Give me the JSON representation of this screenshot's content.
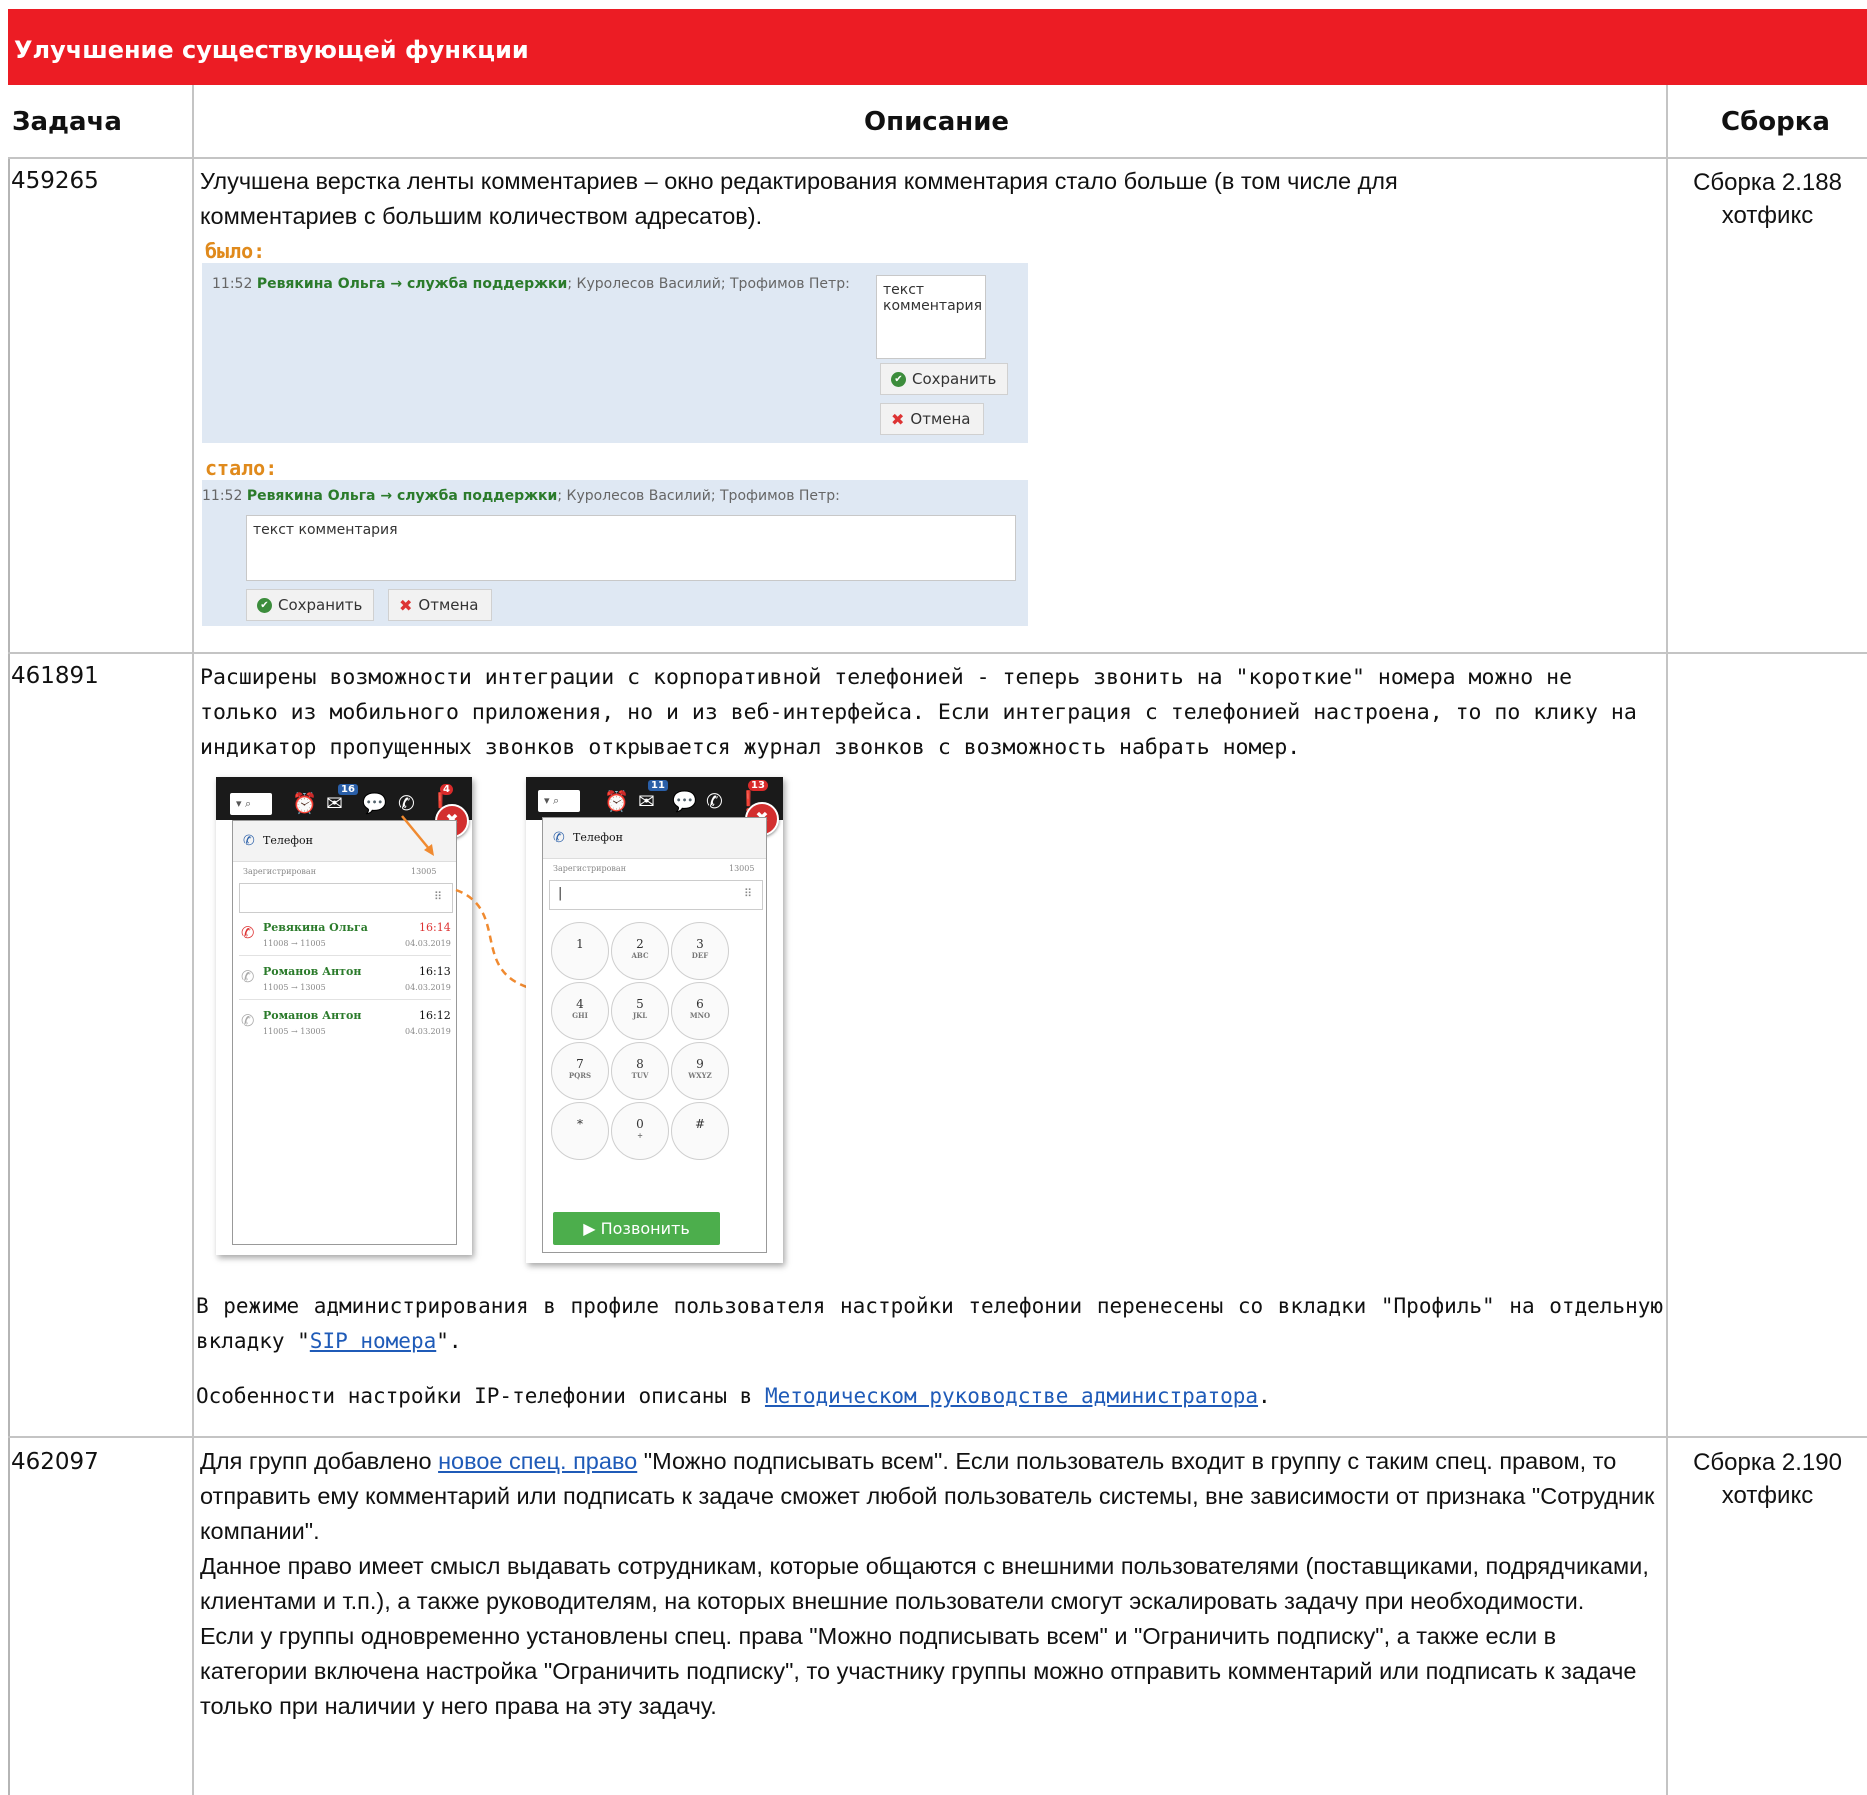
{
  "banner": {
    "title": "Улучшение существующей функции"
  },
  "header": {
    "task": "Задача",
    "description": "Описание",
    "build": "Сборка"
  },
  "rows": [
    {
      "task": "459265",
      "build": "Сборка 2.188 хотфикс",
      "text": "Улучшена верстка ленты комментариев – окно редактирования комментария стало больше (в том числе для комментариев с большим количеством адресатов).",
      "before_label": "было:",
      "after_label": "стало:",
      "comment_time": "11:52",
      "comment_author": "Ревякина Ольга → служба поддержки",
      "comment_recipients": "; Куролесов Василий; Трофимов Петр:",
      "comment_text_old": "текст комментария",
      "comment_text_new": "текст комментария",
      "save": "Сохранить",
      "cancel": "Отмена"
    },
    {
      "task": "461891",
      "build": "",
      "text": "Расширены возможности интеграции с корпоративной телефонией - теперь звонить на \"короткие\" номера можно не только из мобильного приложения, но и из веб-интерфейса. Если интеграция с телефонией настроена, то по клику на индикатор пропущенных звонков открывается журнал звонков с возможность набрать номер.",
      "phone": {
        "title": "Телефон",
        "status": "Зарегистрирован",
        "ext": "13005",
        "badge_mail_left": "16",
        "badge_alert_left": "4",
        "badge_mail_right": "11",
        "badge_alert_right": "13",
        "calls": [
          {
            "name": "Ревякина Ольга",
            "time": "16:14",
            "route": "11008 → 11005",
            "date": "04.03.2019",
            "missed": true
          },
          {
            "name": "Романов Антон",
            "time": "16:13",
            "route": "11005 → 13005",
            "date": "04.03.2019",
            "missed": false
          },
          {
            "name": "Романов Антон",
            "time": "16:12",
            "route": "11005 → 13005",
            "date": "04.03.2019",
            "missed": false
          }
        ],
        "keys": [
          {
            "d": "1",
            "s": ""
          },
          {
            "d": "2",
            "s": "ABC"
          },
          {
            "d": "3",
            "s": "DEF"
          },
          {
            "d": "4",
            "s": "GHI"
          },
          {
            "d": "5",
            "s": "JKL"
          },
          {
            "d": "6",
            "s": "MNO"
          },
          {
            "d": "7",
            "s": "PQRS"
          },
          {
            "d": "8",
            "s": "TUV"
          },
          {
            "d": "9",
            "s": "WXYZ"
          },
          {
            "d": "*",
            "s": ""
          },
          {
            "d": "0",
            "s": "+"
          },
          {
            "d": "#",
            "s": ""
          }
        ],
        "call_button": "▶ Позвонить"
      },
      "admin_text_1": "В режиме администрирования в профиле пользователя настройки телефонии перенесены со вкладки \"Профиль\" на отдельную вкладку \"",
      "admin_link": "SIP номера",
      "admin_text_2": "\".",
      "setup_text": "Особенности настройки IP-телефонии описаны в ",
      "setup_link": "Методическом руководстве администратора",
      "setup_end": "."
    },
    {
      "task": "462097",
      "build": "Сборка 2.190 хотфикс",
      "p1_a": "Для групп добавлено ",
      "p1_link": "новое спец. право",
      "p1_b": " \"Можно подписывать всем\". Если пользователь входит в группу с таким спец. правом, то отправить ему комментарий или подписать к задаче сможет любой пользователь системы, вне зависимости от признака \"Сотрудник компании\".",
      "p2": "Данное право имеет смысл выдавать сотрудникам, которые общаются с внешними пользователями (поставщиками, подрядчиками, клиентами и т.п.), а также руководителям, на которых внешние пользователи смогут эскалировать задачу при необходимости.",
      "p3": "Если у группы одновременно установлены спец. права \"Можно подписывать всем\" и \"Ограничить подписку\", а также если в категории включена настройка \"Ограничить подписку\", то участнику группы можно отправить комментарий или подписать к задаче только при наличии у него права на эту задачу."
    }
  ]
}
